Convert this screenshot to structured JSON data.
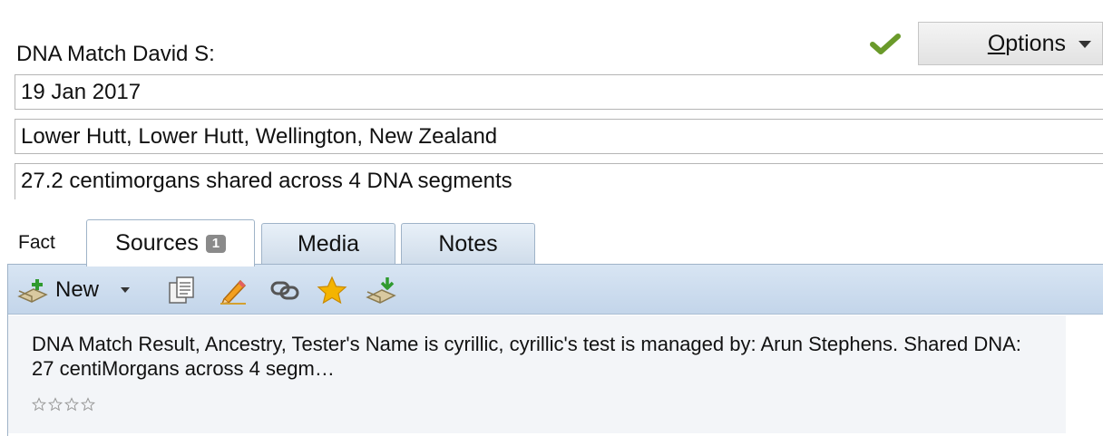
{
  "fact": {
    "title": "DNA Match David S:",
    "date": "19 Jan 2017",
    "place": "Lower Hutt, Lower Hutt, Wellington, New Zealand",
    "description": "27.2 centimorgans shared across 4 DNA segments"
  },
  "header": {
    "options_first": "O",
    "options_rest": "ptions",
    "check_icon": "green-checkmark"
  },
  "tabs": {
    "fact_label": "Fact",
    "items": [
      {
        "label": "Sources",
        "badge": "1",
        "active": true
      },
      {
        "label": "Media",
        "active": false
      },
      {
        "label": "Notes",
        "active": false
      }
    ]
  },
  "toolbar": {
    "new_label": "New",
    "icons": [
      "add-source-icon",
      "copy-source-icon",
      "edit-pencil-icon",
      "link-chain-icon",
      "star-icon",
      "source-attach-icon"
    ]
  },
  "source": {
    "citation": "DNA Match Result, Ancestry, Tester's Name is cyrillic, cyrillic's test is managed by: Arun Stephens. Shared DNA: 27 centiMorgans across 4 segm…",
    "rating_stars_filled": 0,
    "rating_stars_total": 4
  },
  "colors": {
    "tab_active": "#ffffff",
    "tab_inactive": "#dbe6f1",
    "toolbar": "#cfdeee",
    "check": "#6a9a2a",
    "star": "#f0b400"
  }
}
